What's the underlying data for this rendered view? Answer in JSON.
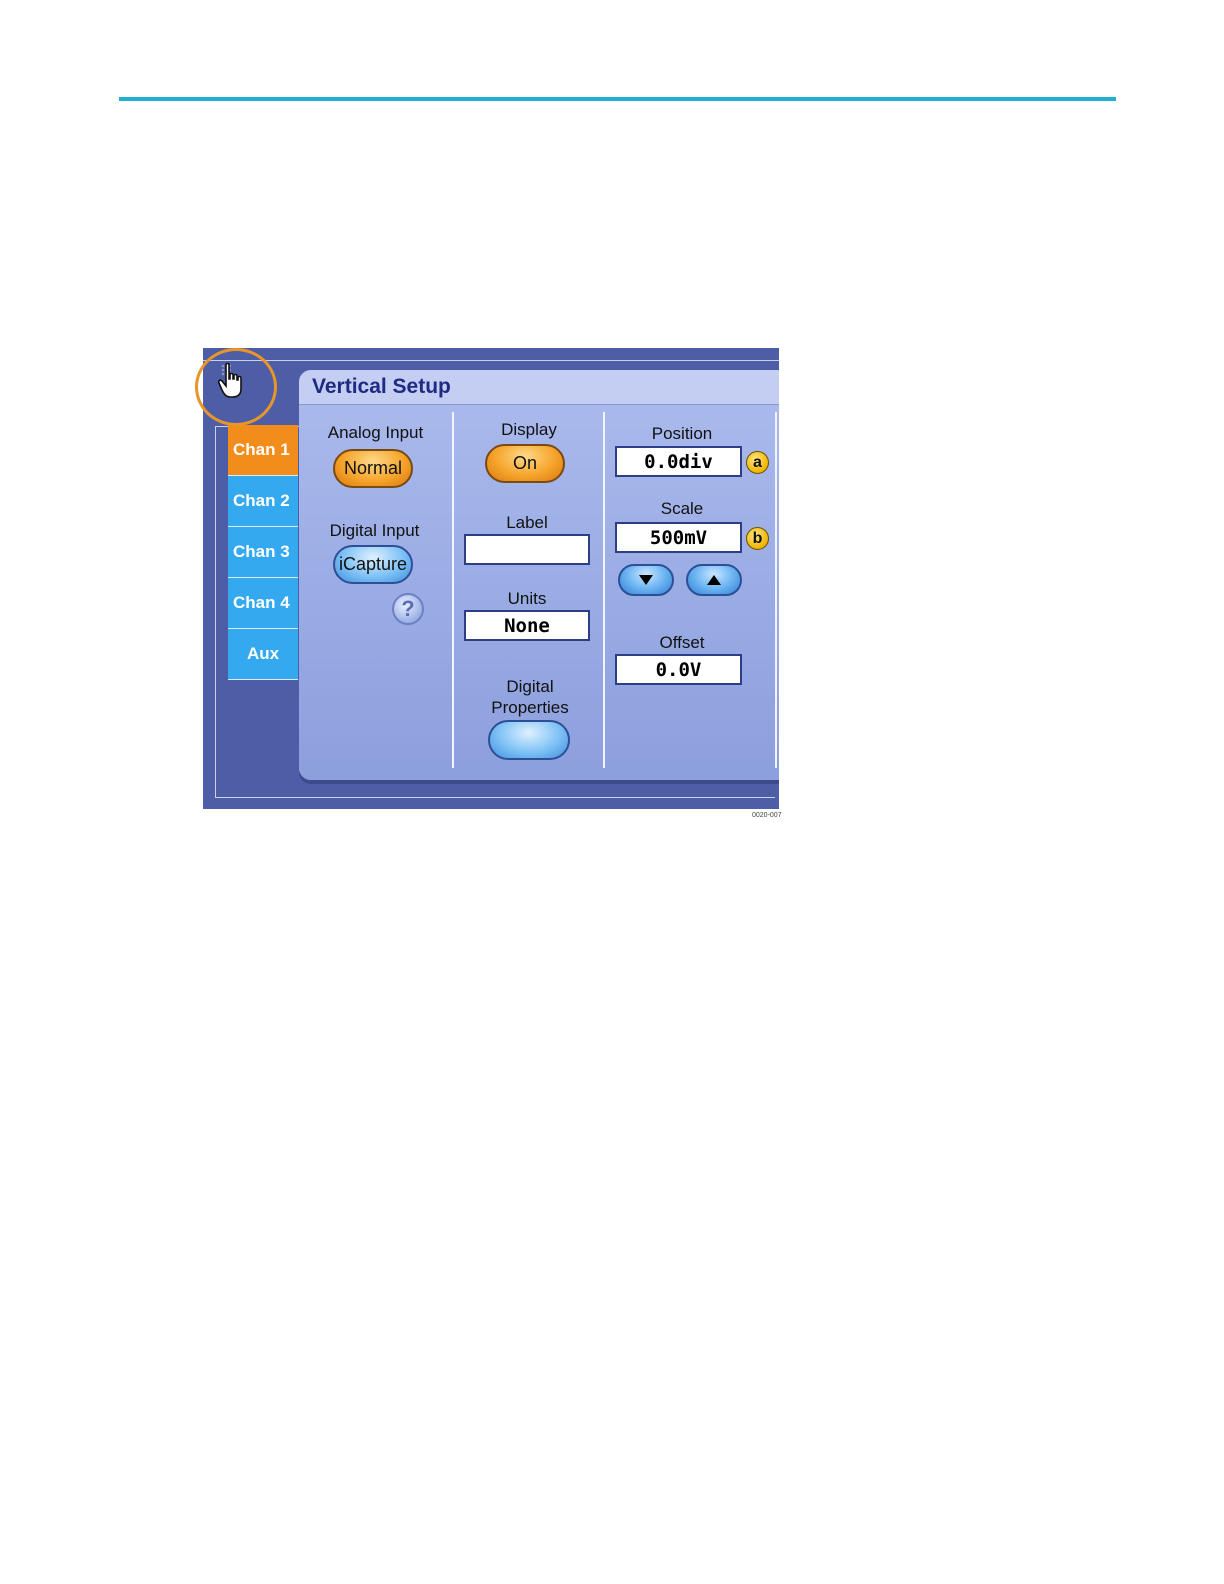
{
  "header": {
    "rule_color": "#1fb0d2"
  },
  "panel": {
    "title": "Vertical Setup",
    "tabs": [
      "Chan 1",
      "Chan 2",
      "Chan 3",
      "Chan 4",
      "Aux"
    ],
    "active_tab": "Chan 1",
    "analog_input": {
      "label": "Analog Input",
      "button": "Normal"
    },
    "digital_input": {
      "label": "Digital Input",
      "button": "iCapture"
    },
    "display": {
      "label": "Display",
      "button": "On"
    },
    "label_field": {
      "label": "Label",
      "value": ""
    },
    "units": {
      "label": "Units",
      "value": "None"
    },
    "digital_properties": {
      "label_line1": "Digital",
      "label_line2": "Properties"
    },
    "position": {
      "label": "Position",
      "value": "0.0div",
      "callout": "a"
    },
    "scale": {
      "label": "Scale",
      "value": "500mV",
      "callout": "b"
    },
    "offset": {
      "label": "Offset",
      "value": "0.0V"
    },
    "help_glyph": "?"
  },
  "figure_id": "0020-007",
  "colors": {
    "accent_orange": "#f28d1c",
    "tab_blue": "#35a9f0",
    "panel_blue": "#9fb0e6"
  },
  "icons": [
    "hand-pointer-icon",
    "help-icon",
    "down-arrow-icon",
    "up-arrow-icon"
  ]
}
